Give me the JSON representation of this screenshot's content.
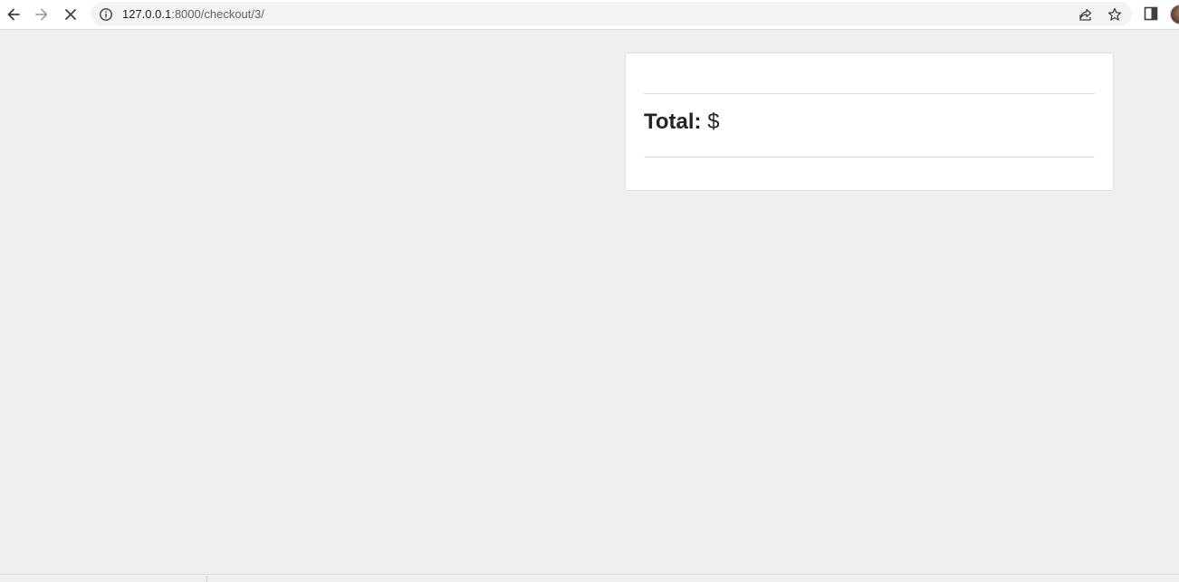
{
  "browser": {
    "url_host": "127.0.0.1",
    "url_path": ":8000/checkout/3/",
    "icons": {
      "back": "arrow-left-icon",
      "forward": "arrow-right-icon",
      "stop": "close-icon",
      "info": "info-icon",
      "share": "share-icon",
      "bookmark": "star-icon",
      "side_panel": "side-panel-icon",
      "profile": "avatar"
    }
  },
  "checkout_summary": {
    "total_label": "Total:",
    "currency_symbol": "$",
    "total_amount": ""
  },
  "colors": {
    "page_background": "#efefef",
    "card_background": "#ffffff",
    "text": "#212529"
  }
}
